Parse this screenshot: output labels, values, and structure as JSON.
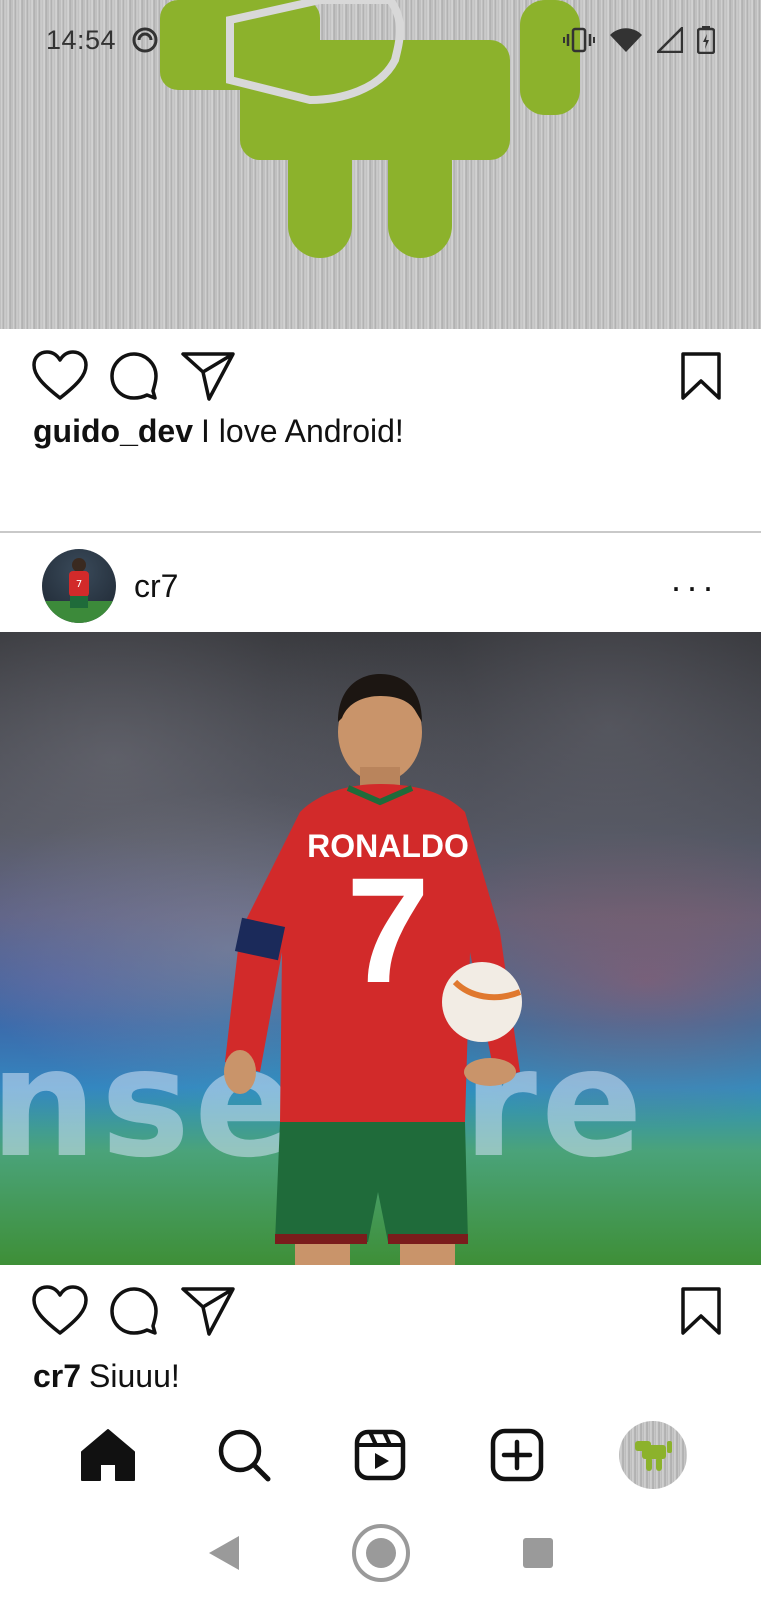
{
  "status_bar": {
    "time": "14:54"
  },
  "posts": [
    {
      "username": "guido_dev",
      "caption": "I love Android!"
    },
    {
      "username": "cr7",
      "caption_user": "cr7",
      "caption": "Siuuu!",
      "more_label": "...",
      "jersey_name": "RONALDO",
      "jersey_number": "7"
    }
  ],
  "colors": {
    "android_green": "#8cb22c",
    "jersey_red": "#d22a2a",
    "shorts_green": "#1f6b3a"
  },
  "bottom_nav": {
    "items": [
      "home-icon",
      "search-icon",
      "reels-icon",
      "add-post-icon",
      "profile-avatar"
    ]
  },
  "system_nav": {
    "items": [
      "back-icon",
      "home-circle-icon",
      "recents-icon"
    ]
  }
}
